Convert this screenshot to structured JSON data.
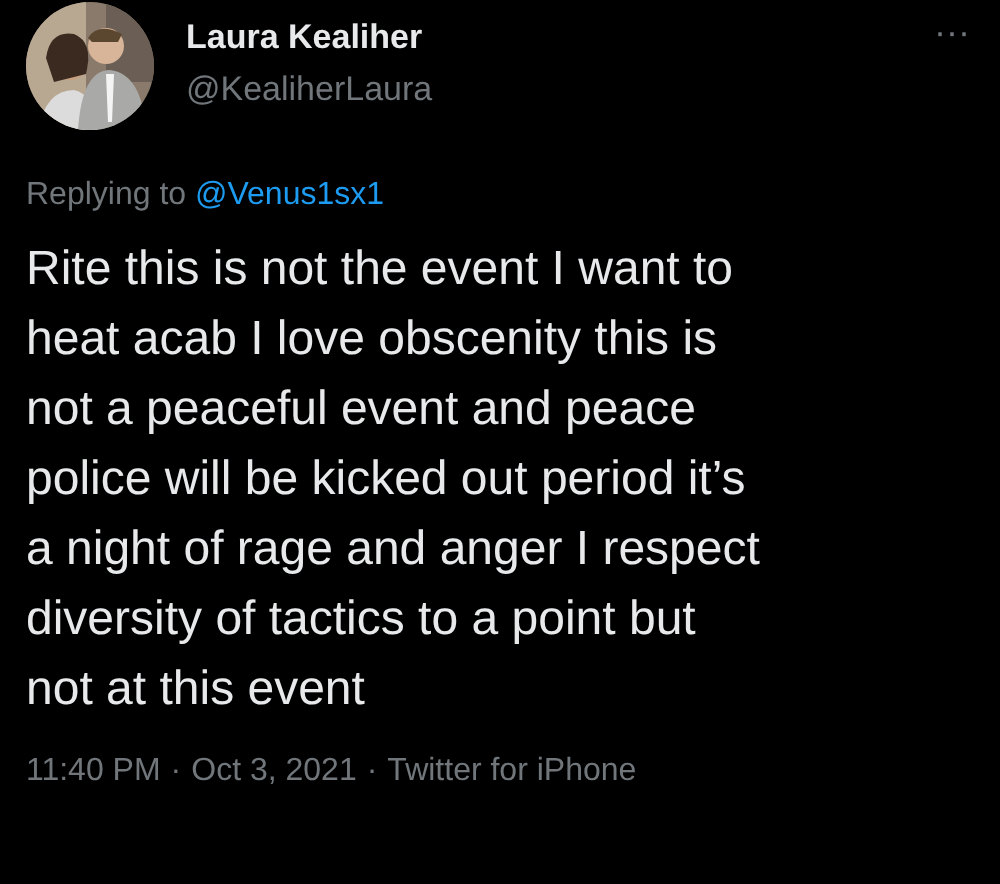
{
  "author": {
    "name": "Laura Kealiher",
    "handle": "@KealiherLaura"
  },
  "more_menu": "···",
  "reply_context": {
    "label": "Replying to",
    "mention": "@Venus1sx1"
  },
  "tweet_text": "Rite this is not the event I want to\nheat acab I love obscenity this is\nnot a peaceful event and peace\npolice will be kicked out period it’s\na night of rage and anger I respect\ndiversity of tactics to a point but\nnot at this event",
  "meta": {
    "time": "11:40 PM",
    "separator_1": "·",
    "date": "Oct 3, 2021",
    "separator_2": "·",
    "source": "Twitter for iPhone"
  }
}
